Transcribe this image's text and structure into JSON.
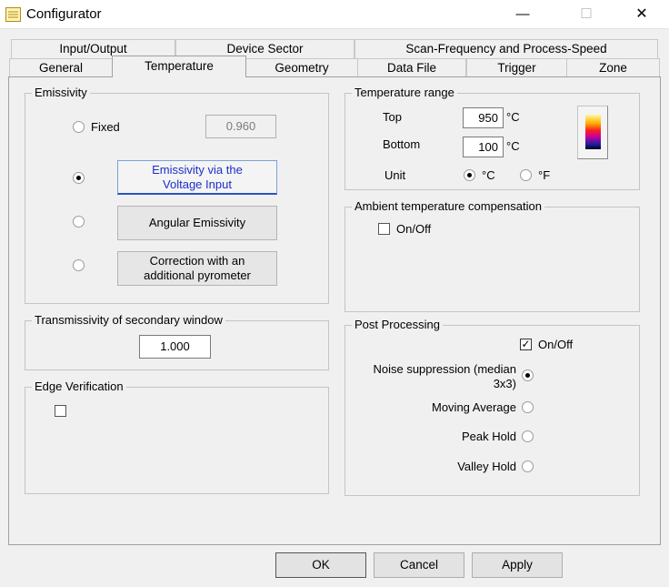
{
  "window": {
    "title": "Configurator",
    "minimize": "—",
    "maximize": "☐",
    "close": "✕"
  },
  "tabs": {
    "row1": [
      "Input/Output",
      "Device Sector",
      "Scan-Frequency and Process-Speed"
    ],
    "row2": [
      "General",
      "Temperature",
      "Geometry",
      "Data File",
      "Trigger",
      "Zone"
    ],
    "active": "Temperature"
  },
  "emissivity": {
    "title": "Emissivity",
    "fixed_label": "Fixed",
    "fixed_value": "0.960",
    "voltage_label": "Emissivity via the\nVoltage Input",
    "angular_label": "Angular Emissivity",
    "pyrometer_label": "Correction with an\nadditional pyrometer",
    "selected": "voltage"
  },
  "transmissivity": {
    "title": "Transmissivity of secondary window",
    "value": "1.000"
  },
  "edge": {
    "title": "Edge Verification",
    "checked": false
  },
  "temperature_range": {
    "title": "Temperature range",
    "top_label": "Top",
    "top_value": "950",
    "top_unit": "°C",
    "bottom_label": "Bottom",
    "bottom_value": "100",
    "bottom_unit": "°C",
    "unit_label": "Unit",
    "unit_c": "°C",
    "unit_f": "°F",
    "selected_unit": "C",
    "palette_icon": "color-palette-icon"
  },
  "ambient": {
    "title": "Ambient temperature compensation",
    "onoff_label": "On/Off",
    "checked": false
  },
  "post": {
    "title": "Post Processing",
    "onoff_label": "On/Off",
    "checked": true,
    "noise_label": "Noise suppression (median\n3x3)",
    "moving_label": "Moving Average",
    "peak_label": "Peak Hold",
    "valley_label": "Valley Hold",
    "selected": "noise"
  },
  "footer": {
    "ok": "OK",
    "cancel": "Cancel",
    "apply": "Apply"
  }
}
